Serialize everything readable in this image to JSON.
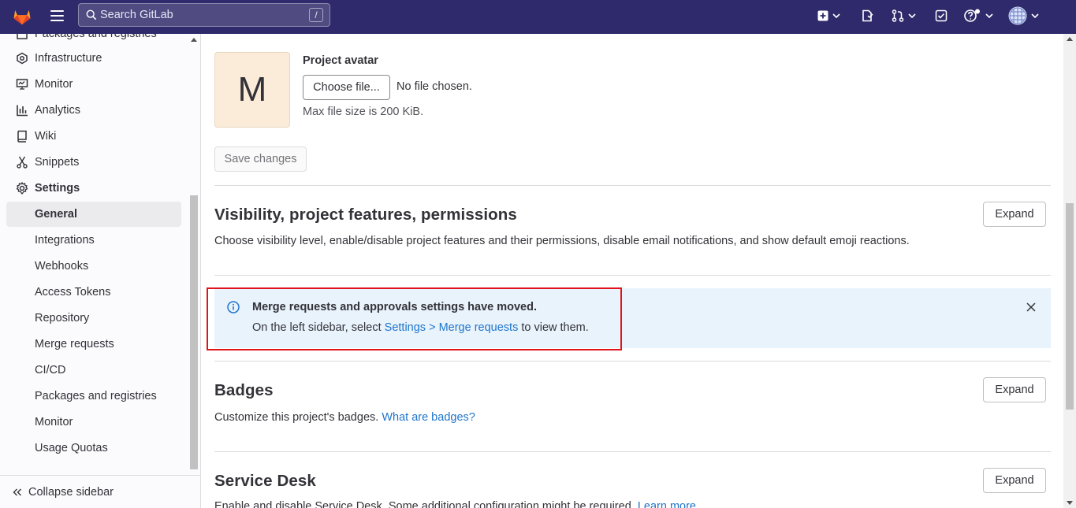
{
  "topbar": {
    "search_placeholder": "Search GitLab",
    "search_shortcut": "/",
    "icons": [
      "gitlab-logo",
      "hamburger-icon",
      "search-icon",
      "create-new-icon",
      "issues-icon",
      "merge-requests-icon",
      "todo-icon",
      "help-icon",
      "user-avatar"
    ]
  },
  "sidebar": {
    "items": [
      {
        "label": "Packages and registries",
        "icon": "package-icon"
      },
      {
        "label": "Infrastructure",
        "icon": "cloud-gear-icon"
      },
      {
        "label": "Monitor",
        "icon": "monitor-icon"
      },
      {
        "label": "Analytics",
        "icon": "chart-icon"
      },
      {
        "label": "Wiki",
        "icon": "book-icon"
      },
      {
        "label": "Snippets",
        "icon": "snippet-icon"
      },
      {
        "label": "Settings",
        "icon": "settings-icon"
      },
      {
        "label": "General"
      },
      {
        "label": "Integrations"
      },
      {
        "label": "Webhooks"
      },
      {
        "label": "Access Tokens"
      },
      {
        "label": "Repository"
      },
      {
        "label": "Merge requests"
      },
      {
        "label": "CI/CD"
      },
      {
        "label": "Packages and registries"
      },
      {
        "label": "Monitor"
      },
      {
        "label": "Usage Quotas"
      }
    ],
    "collapse_label": "Collapse sidebar"
  },
  "avatar": {
    "initial": "M",
    "title": "Project avatar",
    "choose_file": "Choose file...",
    "no_file": "No file chosen.",
    "max_size": "Max file size is 200 KiB.",
    "bg_color": "#fbecd9"
  },
  "save_changes": "Save changes",
  "sections": {
    "visibility": {
      "title": "Visibility, project features, permissions",
      "desc": "Choose visibility level, enable/disable project features and their permissions, disable email notifications, and show default emoji reactions.",
      "expand": "Expand"
    },
    "badges": {
      "title": "Badges",
      "desc": "Customize this project's badges.",
      "link": "What are badges?",
      "expand": "Expand"
    },
    "service_desk": {
      "title": "Service Desk",
      "desc": "Enable and disable Service Desk. Some additional configuration might be required.",
      "link": "Learn more",
      "expand": "Expand"
    }
  },
  "alert": {
    "title": "Merge requests and approvals settings have moved.",
    "body_prefix": "On the left sidebar, select ",
    "link": "Settings > Merge requests",
    "body_suffix": " to view them.",
    "bg_color": "#e9f3fc",
    "highlight_color": "#e0141b"
  },
  "colors": {
    "navbar": "#2f2a6b",
    "link": "#1f75cb"
  }
}
